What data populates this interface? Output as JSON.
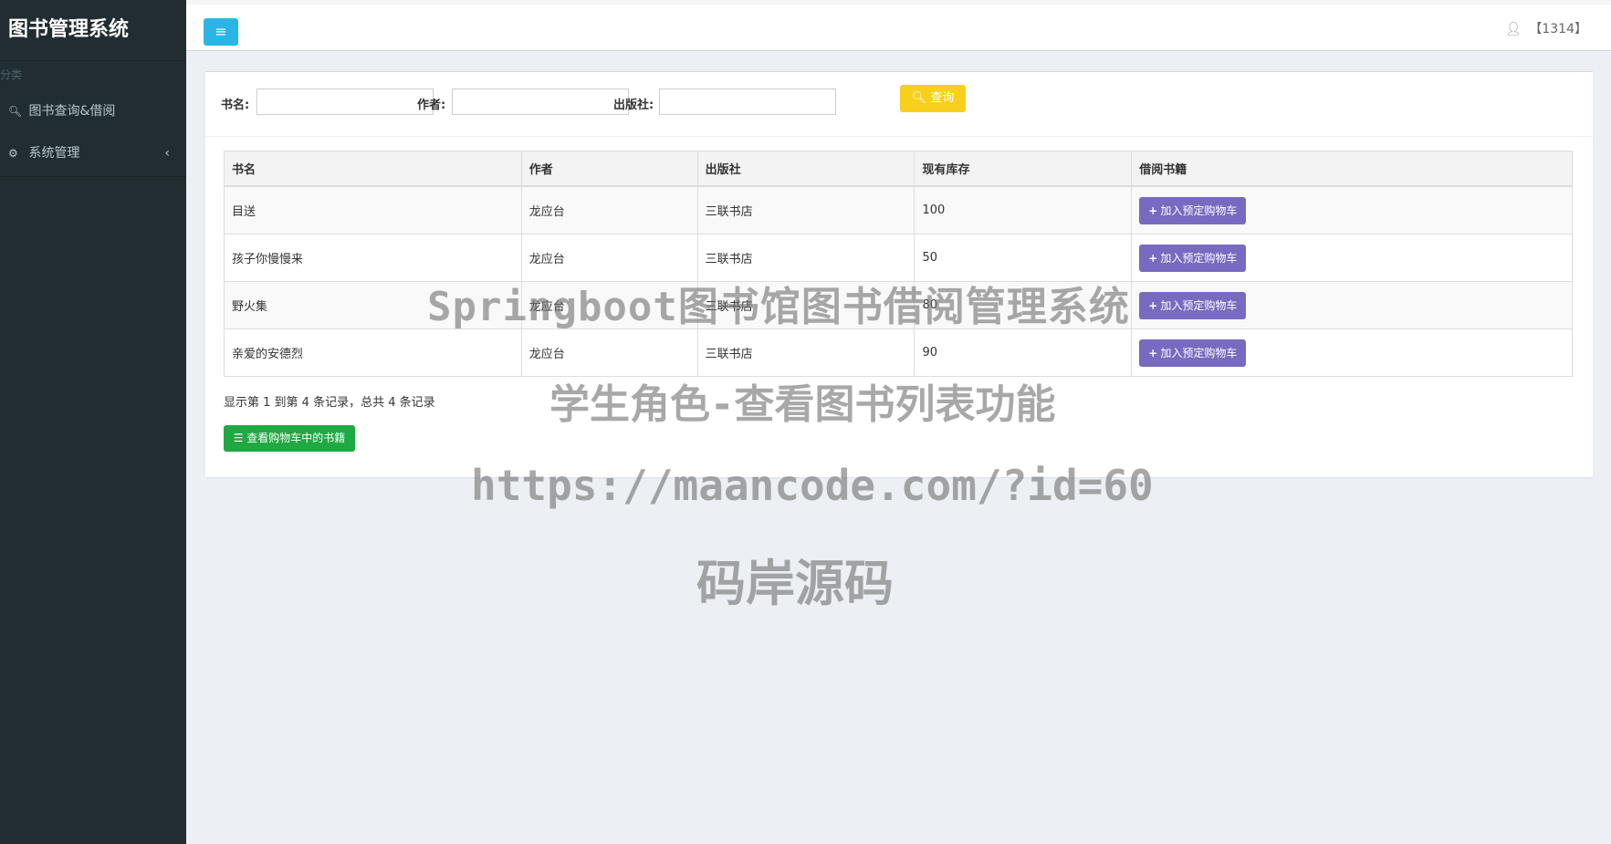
{
  "app": {
    "title": "图书管理系统"
  },
  "sidebar": {
    "section": "分类",
    "items": [
      {
        "label": "图书查询&借阅",
        "icon": "search-icon"
      },
      {
        "label": "系统管理",
        "icon": "gear-icon",
        "has_chevron": true
      }
    ]
  },
  "header": {
    "user_label": "【1314】"
  },
  "search": {
    "title_label": "书名:",
    "author_label": "作者:",
    "publisher_label": "出版社:",
    "title_value": "",
    "author_value": "",
    "publisher_value": "",
    "query_label": "查询"
  },
  "table": {
    "columns": [
      "书名",
      "作者",
      "出版社",
      "现有库存",
      "借阅书籍"
    ],
    "rows": [
      {
        "title": "目送",
        "author": "龙应台",
        "publisher": "三联书店",
        "stock": "100",
        "action": "加入预定购物车"
      },
      {
        "title": "孩子你慢慢来",
        "author": "龙应台",
        "publisher": "三联书店",
        "stock": "50",
        "action": "加入预定购物车"
      },
      {
        "title": "野火集",
        "author": "龙应台",
        "publisher": "三联书店",
        "stock": "80",
        "action": "加入预定购物车"
      },
      {
        "title": "亲爱的安德烈",
        "author": "龙应台",
        "publisher": "三联书店",
        "stock": "90",
        "action": "加入预定购物车"
      }
    ]
  },
  "pagination": {
    "summary": "显示第 1 到第 4 条记录，总共 4 条记录"
  },
  "cart_button": {
    "label": "查看购物车中的书籍"
  },
  "watermark": {
    "line1": "Springboot图书馆图书借阅管理系统",
    "line2": "学生角色-查看图书列表功能",
    "line3": "https://maancode.com/?id=60",
    "line4": "码岸源码"
  },
  "colors": {
    "sidebar_bg": "#222d32",
    "toggle_btn": "#29b6e6",
    "query_btn": "#f8cf1c",
    "add_btn": "#786ac0",
    "cart_btn": "#20a842"
  }
}
